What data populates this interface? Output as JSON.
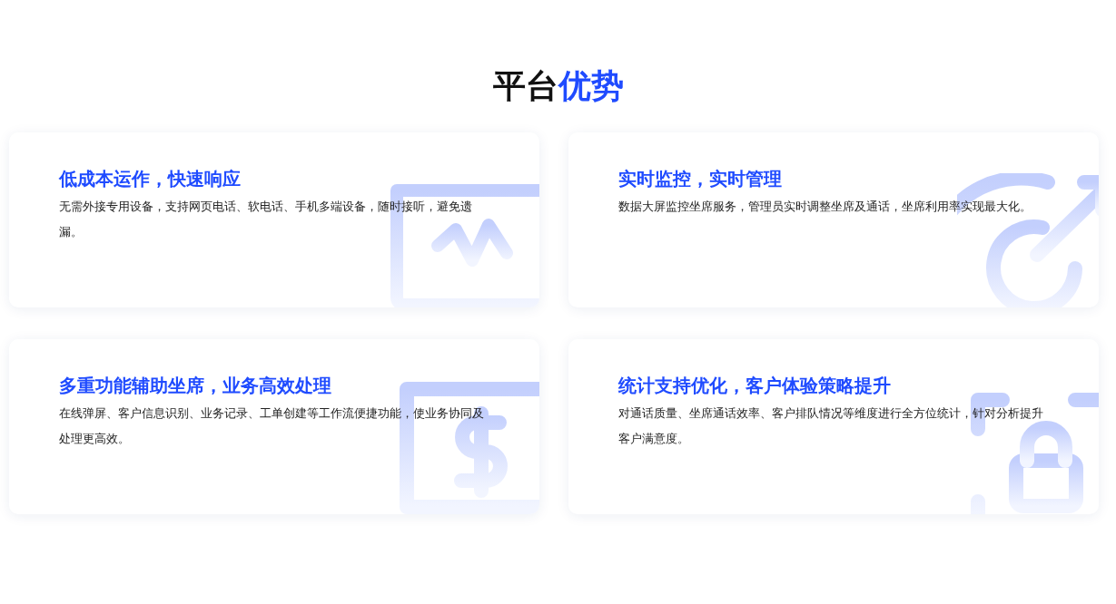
{
  "heading": {
    "plain": "平台",
    "accent": "优势"
  },
  "cards": [
    {
      "title": "低成本运作，快速响应",
      "description": "无需外接专用设备，支持网页电话、软电话、手机多端设备，随时接听，避免遗漏。"
    },
    {
      "title": "实时监控，实时管理",
      "description": "数据大屏监控坐席服务，管理员实时调整坐席及通话，坐席利用率实现最大化。"
    },
    {
      "title": "多重功能辅助坐席，业务高效处理",
      "description": "在线弹屏、客户信息识别、业务记录、工单创建等工作流便捷功能，使业务协同及处理更高效。"
    },
    {
      "title": "统计支持优化，客户体验策略提升",
      "description": "对通话质量、坐席通话效率、客户排队情况等维度进行全方位统计，针对分析提升客户满意度。"
    }
  ]
}
